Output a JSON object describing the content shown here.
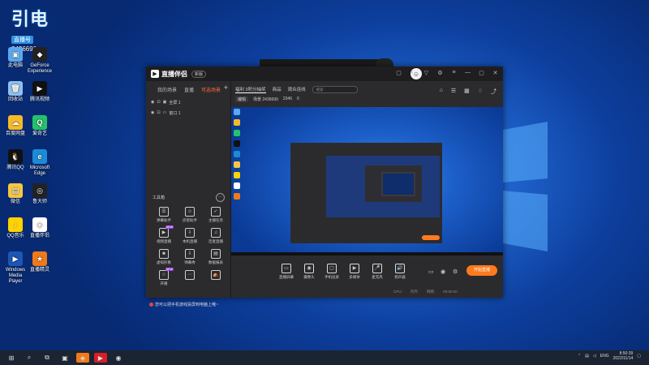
{
  "watermark": {
    "big": "引电",
    "tag": "直播号",
    "number": "2436690"
  },
  "desktop_icons": [
    {
      "label": "此电脑",
      "color": "#5aa8f0",
      "glyph": "▣"
    },
    {
      "label": "GeForce Experience",
      "color": "#222",
      "glyph": "◆"
    },
    {
      "label": "回收站",
      "color": "#8fc1ee",
      "glyph": "🗑"
    },
    {
      "label": "腾讯视频",
      "color": "#111",
      "glyph": "▶"
    },
    {
      "label": "百度网盘",
      "color": "#f5b92b",
      "glyph": "☁"
    },
    {
      "label": "爱奇艺",
      "color": "#24c36b",
      "glyph": "Q"
    },
    {
      "label": "腾讯QQ",
      "color": "#111",
      "glyph": "🐧"
    },
    {
      "label": "Microsoft Edge",
      "color": "#1b8bd8",
      "glyph": "e"
    },
    {
      "label": "微信",
      "color": "#f5c742",
      "glyph": "▤"
    },
    {
      "label": "鲁大师",
      "color": "#222",
      "glyph": "◎"
    },
    {
      "label": "QQ音乐",
      "color": "#ffd300",
      "glyph": "♪"
    },
    {
      "label": "直播伴侣",
      "color": "#ffffff",
      "glyph": "◈"
    },
    {
      "label": "Windows Media Player",
      "color": "#1e56b5",
      "glyph": "▶"
    },
    {
      "label": "直播精灵",
      "color": "#f07a1a",
      "glyph": "★"
    }
  ],
  "app": {
    "title": "直播伴侣",
    "version": "新版",
    "left_tabs": [
      "我的场景",
      "直播",
      "可选场景"
    ],
    "left_active": "可选场景",
    "scenes": [
      {
        "label": "全屏 1"
      },
      {
        "label": "窗口 1"
      }
    ],
    "tools_title": "工具箱",
    "tools": [
      {
        "label": "弹幕助手",
        "glyph": "☰"
      },
      {
        "label": "房管助手",
        "glyph": "☺"
      },
      {
        "label": "主播任务",
        "glyph": "✓"
      },
      {
        "label": "视频直播",
        "glyph": "▶",
        "badge": "NEW"
      },
      {
        "label": "本机直播",
        "glyph": "⇩"
      },
      {
        "label": "连麦直播",
        "glyph": "♫"
      },
      {
        "label": "虚拟形象",
        "glyph": "☻"
      },
      {
        "label": "弹幕秀",
        "glyph": "⇩"
      },
      {
        "label": "数据报表",
        "glyph": "▤"
      },
      {
        "label": "开播",
        "glyph": "☆",
        "badge": "NEW"
      },
      {
        "label": "",
        "glyph": "⋯"
      },
      {
        "label": "",
        "glyph": "⛺"
      }
    ],
    "notice": "您可以把手机游戏投屏到电脑上哦~",
    "right_tabs": [
      "福利 3积分抽奖",
      "商品",
      "观众连线"
    ],
    "search_placeholder": "搜索",
    "subbar": [
      "编辑",
      "场景 2436690",
      "2346",
      "0"
    ],
    "bottom_items": [
      {
        "label": "直播屏幕",
        "glyph": "▭"
      },
      {
        "label": "摄像头",
        "glyph": "◉"
      },
      {
        "label": "手机投屏",
        "glyph": "▢"
      },
      {
        "label": "多媒体",
        "glyph": "▶"
      },
      {
        "label": "麦克风",
        "glyph": "🎤"
      },
      {
        "label": "扬声器",
        "glyph": "🔊"
      }
    ],
    "start_label": "开始直播",
    "status": [
      "CPU:",
      "内存:",
      "网络:",
      "00:00:00"
    ]
  },
  "taskbar": {
    "items": [
      "⊞",
      "⌕",
      "⧉",
      "▣",
      "◈",
      "▶",
      "◉"
    ],
    "lang": "ENG",
    "time": "8:50:39",
    "date": "2022/11/14"
  }
}
